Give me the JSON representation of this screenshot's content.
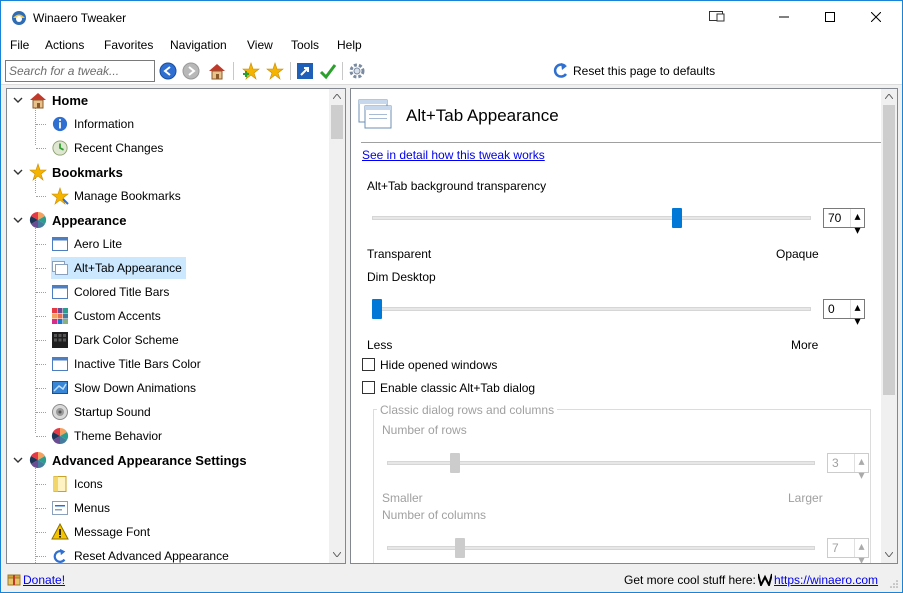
{
  "window": {
    "title": "Winaero Tweaker"
  },
  "menu": [
    "File",
    "Actions",
    "Favorites",
    "Navigation",
    "View",
    "Tools",
    "Help"
  ],
  "toolbar": {
    "search_placeholder": "Search for a tweak...",
    "reset_label": "Reset this page to defaults"
  },
  "tree": {
    "items": [
      {
        "label": "Home",
        "icon": "home-icon",
        "level": 0
      },
      {
        "label": "Information",
        "icon": "info-icon",
        "level": 1
      },
      {
        "label": "Recent Changes",
        "icon": "recent-changes-icon",
        "level": 1
      },
      {
        "label": "Bookmarks",
        "icon": "star-icon",
        "level": 0
      },
      {
        "label": "Manage Bookmarks",
        "icon": "manage-bookmarks-icon",
        "level": 1
      },
      {
        "label": "Appearance",
        "icon": "color-wheel-icon",
        "level": 0
      },
      {
        "label": "Aero Lite",
        "icon": "window-icon",
        "level": 1
      },
      {
        "label": "Alt+Tab Appearance",
        "icon": "alt-tab-icon",
        "level": 1
      },
      {
        "label": "Colored Title Bars",
        "icon": "window-icon",
        "level": 1
      },
      {
        "label": "Custom Accents",
        "icon": "accents-icon",
        "level": 1
      },
      {
        "label": "Dark Color Scheme",
        "icon": "dark-scheme-icon",
        "level": 1
      },
      {
        "label": "Inactive Title Bars Color",
        "icon": "window-icon",
        "level": 1
      },
      {
        "label": "Slow Down Animations",
        "icon": "animation-icon",
        "level": 1
      },
      {
        "label": "Startup Sound",
        "icon": "speaker-icon",
        "level": 1
      },
      {
        "label": "Theme Behavior",
        "icon": "color-wheel-icon",
        "level": 1
      },
      {
        "label": "Advanced Appearance Settings",
        "icon": "color-wheel-icon",
        "level": 0
      },
      {
        "label": "Icons",
        "icon": "folder-icon",
        "level": 1
      },
      {
        "label": "Menus",
        "icon": "menu-icon",
        "level": 1
      },
      {
        "label": "Message Font",
        "icon": "warning-icon",
        "level": 1
      },
      {
        "label": "Reset Advanced Appearance",
        "icon": "reset-icon",
        "level": 1
      }
    ],
    "selected": "Alt+Tab Appearance"
  },
  "page": {
    "title": "Alt+Tab Appearance",
    "detail_link": "See in detail how this tweak works",
    "transparency": {
      "label": "Alt+Tab background transparency",
      "value": "70",
      "fraction": 0.7,
      "min_label": "Transparent",
      "max_label": "Opaque"
    },
    "dim": {
      "label": "Dim Desktop",
      "value": "0",
      "fraction": 0.0,
      "min_label": "Less",
      "max_label": "More"
    },
    "hide_windows": {
      "label": "Hide opened windows",
      "checked": false
    },
    "classic_dialog": {
      "label": "Enable classic Alt+Tab dialog",
      "checked": false
    },
    "classic_group": {
      "title": "Classic dialog rows and columns",
      "rows": {
        "label": "Number of rows",
        "value": "3",
        "fraction": 0.15,
        "min_label": "Smaller",
        "max_label": "Larger"
      },
      "columns": {
        "label": "Number of columns",
        "value": "7"
      }
    }
  },
  "status": {
    "donate": "Donate!",
    "more": "Get more cool stuff here:",
    "url": "https://winaero.com"
  }
}
